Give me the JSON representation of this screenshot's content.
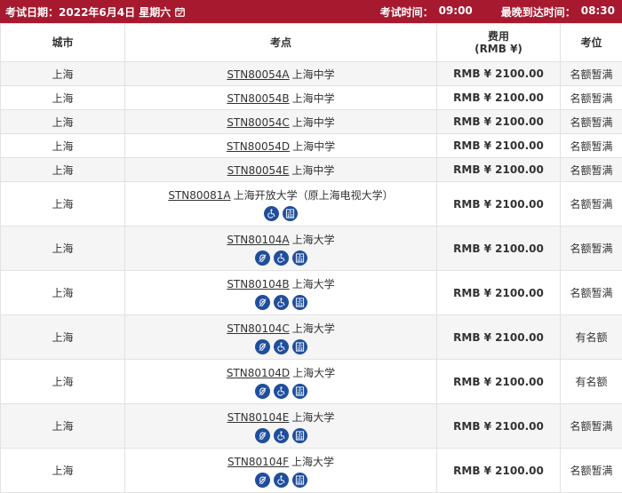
{
  "header": {
    "date_label": "考试日期：",
    "date_value": "2022年6月4日 星期六",
    "exam_time_label": "考试时间：",
    "exam_time_value": "09:00",
    "latest_arrival_label": "最晚到达时间：",
    "latest_arrival_value": "08:30"
  },
  "table": {
    "columns": [
      "城市",
      "考点",
      "费用\n(RMB ¥)",
      "考位"
    ],
    "rows": [
      {
        "city": "上海",
        "code": "STN80054A",
        "name": "上海中学",
        "fee": "RMB ¥ 2100.00",
        "status": "名额暂满",
        "icons": []
      },
      {
        "city": "上海",
        "code": "STN80054B",
        "name": "上海中学",
        "fee": "RMB ¥ 2100.00",
        "status": "名额暂满",
        "icons": []
      },
      {
        "city": "上海",
        "code": "STN80054C",
        "name": "上海中学",
        "fee": "RMB ¥ 2100.00",
        "status": "名额暂满",
        "icons": []
      },
      {
        "city": "上海",
        "code": "STN80054D",
        "name": "上海中学",
        "fee": "RMB ¥ 2100.00",
        "status": "名额暂满",
        "icons": []
      },
      {
        "city": "上海",
        "code": "STN80054E",
        "name": "上海中学",
        "fee": "RMB ¥ 2100.00",
        "status": "名额暂满",
        "icons": []
      },
      {
        "city": "上海",
        "code": "STN80081A",
        "name": "上海开放大学（原上海电视大学）",
        "fee": "RMB ¥ 2100.00",
        "status": "名额暂满",
        "icons": [
          "wheelchair-icon",
          "elevator-icon"
        ]
      },
      {
        "city": "上海",
        "code": "STN80104A",
        "name": "上海大学",
        "fee": "RMB ¥ 2100.00",
        "status": "名额暂满",
        "icons": [
          "hearing-icon",
          "wheelchair-icon",
          "elevator-icon"
        ]
      },
      {
        "city": "上海",
        "code": "STN80104B",
        "name": "上海大学",
        "fee": "RMB ¥ 2100.00",
        "status": "名额暂满",
        "icons": [
          "hearing-icon",
          "wheelchair-icon",
          "elevator-icon"
        ]
      },
      {
        "city": "上海",
        "code": "STN80104C",
        "name": "上海大学",
        "fee": "RMB ¥ 2100.00",
        "status": "有名额",
        "icons": [
          "hearing-icon",
          "wheelchair-icon",
          "elevator-icon"
        ]
      },
      {
        "city": "上海",
        "code": "STN80104D",
        "name": "上海大学",
        "fee": "RMB ¥ 2100.00",
        "status": "有名额",
        "icons": [
          "hearing-icon",
          "wheelchair-icon",
          "elevator-icon"
        ]
      },
      {
        "city": "上海",
        "code": "STN80104E",
        "name": "上海大学",
        "fee": "RMB ¥ 2100.00",
        "status": "名额暂满",
        "icons": [
          "hearing-icon",
          "wheelchair-icon",
          "elevator-icon"
        ]
      },
      {
        "city": "上海",
        "code": "STN80104F",
        "name": "上海大学",
        "fee": "RMB ¥ 2100.00",
        "status": "名额暂满",
        "icons": [
          "hearing-icon",
          "wheelchair-icon",
          "elevator-icon"
        ]
      }
    ]
  },
  "colors": {
    "header_bar": "#a6192e",
    "icon_badge": "#1f4e9c",
    "row_alt": "#f5f5f5",
    "border": "#e2e2e2"
  }
}
